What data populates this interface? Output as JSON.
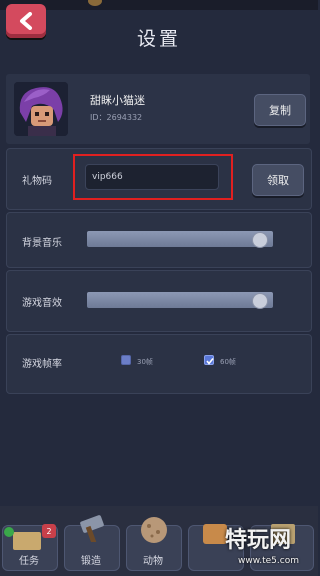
{
  "header": {
    "title": "设置"
  },
  "profile": {
    "nickname": "甜眯小猫迷",
    "uid": "ID：2694332",
    "copy_label": "复制"
  },
  "gift": {
    "label": "礼物码",
    "input_value": "vip666",
    "claim_label": "领取"
  },
  "audio": {
    "music_label": "背景音乐",
    "music_level": 0.97,
    "sfx_label": "游戏音效",
    "sfx_level": 0.97
  },
  "framerate": {
    "label": "游戏帧率",
    "options": [
      {
        "label": "30帧",
        "checked": false
      },
      {
        "label": "60帧",
        "checked": true
      }
    ]
  },
  "bottom_nav": {
    "tabs": [
      {
        "label": "任务",
        "badge": "2"
      },
      {
        "label": "锻造"
      },
      {
        "label": "动物"
      },
      {
        "label": ""
      },
      {
        "label": ""
      }
    ]
  },
  "watermark": {
    "main": "特玩网",
    "sub": "www.te5.com"
  },
  "colors": {
    "back_button": "#d44a5e",
    "highlight_box": "#e02020",
    "background": "#242a3d"
  }
}
